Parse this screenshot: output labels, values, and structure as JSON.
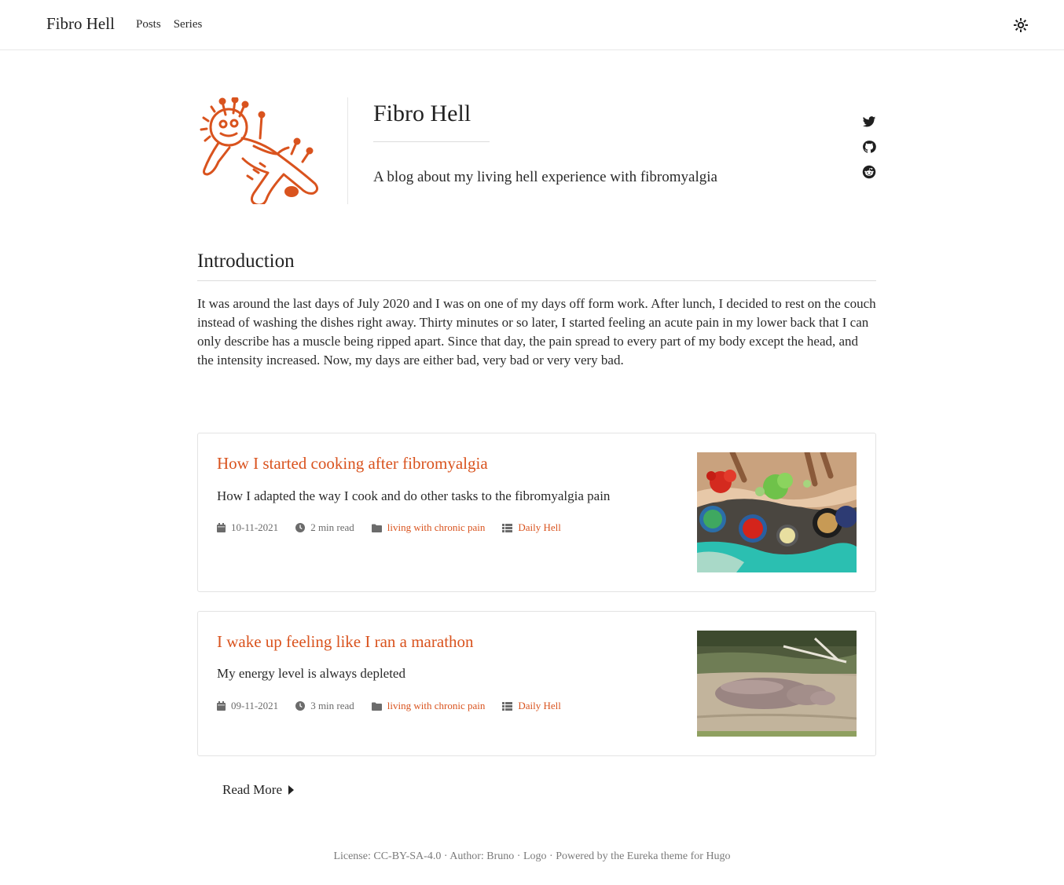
{
  "header": {
    "brand": "Fibro Hell",
    "nav": [
      {
        "label": "Posts"
      },
      {
        "label": "Series"
      }
    ],
    "theme_icon": "sun-icon"
  },
  "profile": {
    "avatar_icon": "voodoo-doll-logo",
    "title": "Fibro Hell",
    "tagline": "A blog about my living hell experience with fibromyalgia",
    "socials": [
      "twitter-icon",
      "github-icon",
      "reddit-icon"
    ]
  },
  "intro": {
    "heading": "Introduction",
    "text": "It was around the last days of July 2020 and I was on one of my days off form work. After lunch, I decided to rest on the couch instead of washing the dishes right away. Thirty minutes or so later, I started feeling an acute pain in my lower back that I can only describe has a muscle being ripped apart. Since that day, the pain spread to every part of my body except the head, and the intensity increased. Now, my days are either bad, very bad or very very bad."
  },
  "posts": [
    {
      "title": "How I started cooking after fibromyalgia",
      "summary": "How I adapted the way I cook and do other tasks to the fibromyalgia pain",
      "date": "10-11-2021",
      "read_time": "2 min read",
      "category": "living with chronic pain",
      "series": "Daily Hell"
    },
    {
      "title": "I wake up feeling like I ran a marathon",
      "summary": "My energy level is always depleted",
      "date": "09-11-2021",
      "read_time": "3 min read",
      "category": "living with chronic pain",
      "series": "Daily Hell"
    }
  ],
  "read_more": "Read More",
  "footer": {
    "license": "License: CC-BY-SA-4.0",
    "author": "Author: Bruno",
    "logo": "Logo",
    "powered": "Powered by the Eureka theme for Hugo",
    "sep": " · "
  },
  "colors": {
    "accent": "#d9531e",
    "text": "#262626",
    "muted": "#6b6b6b",
    "border": "#e3e3e3"
  }
}
